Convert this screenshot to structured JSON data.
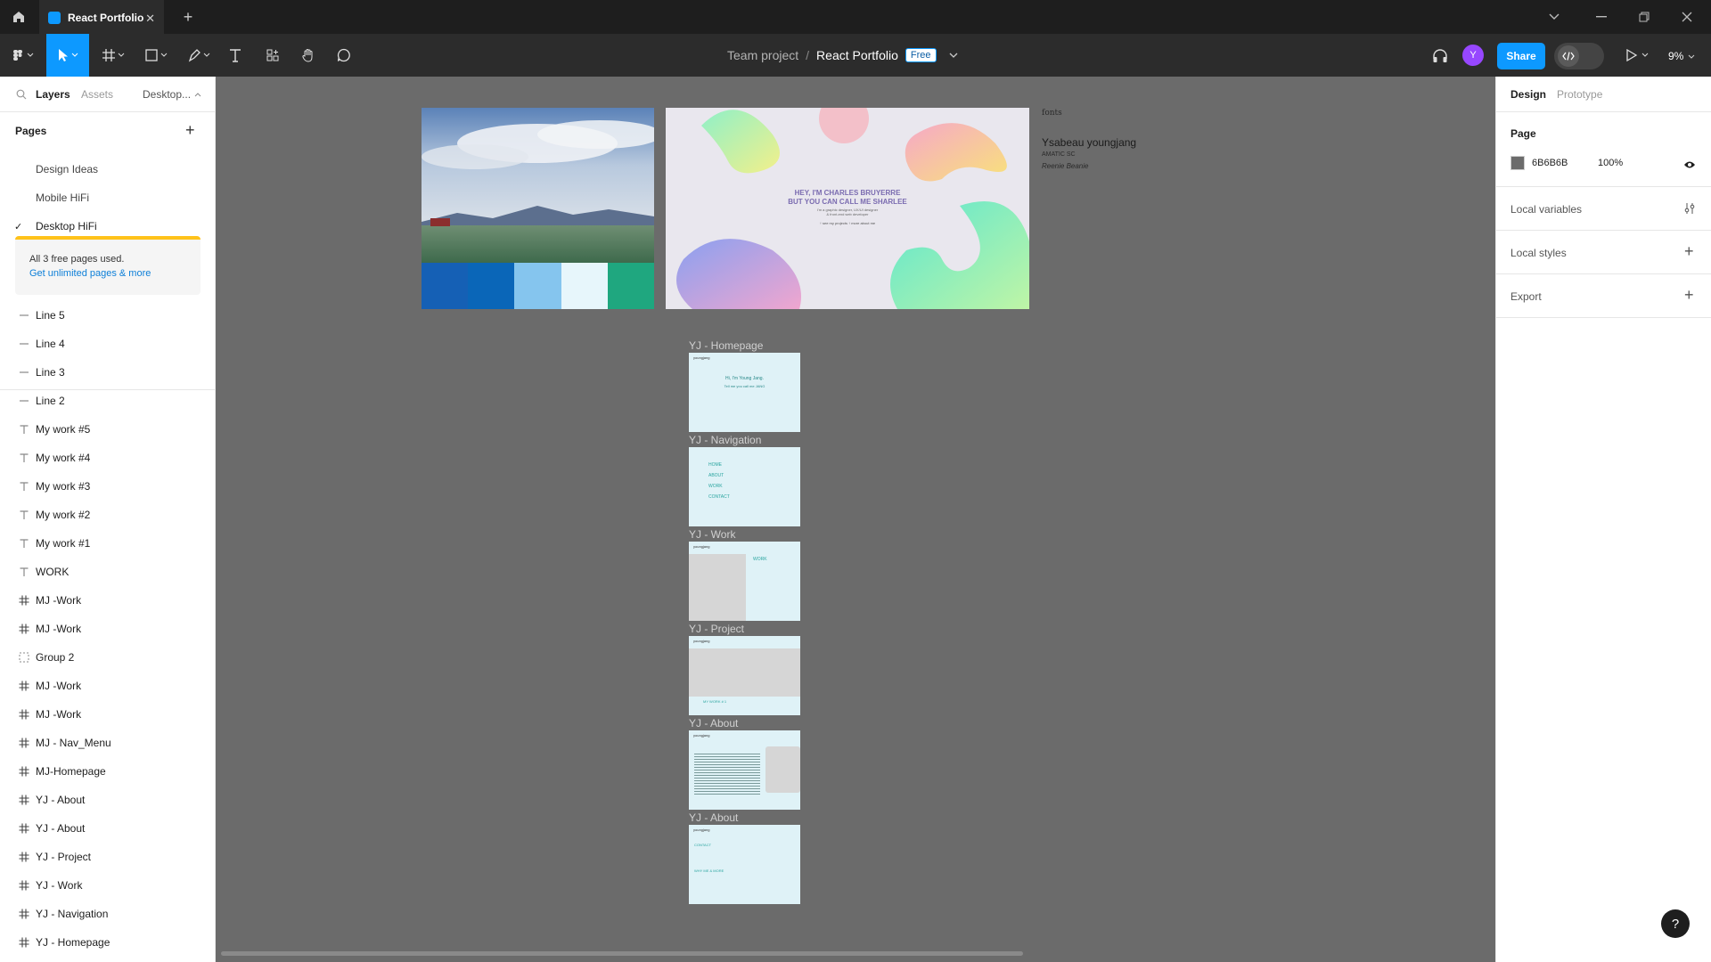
{
  "tabbar": {
    "tab_title": "React Portfolio"
  },
  "toolbar": {
    "breadcrumb_team": "Team project",
    "breadcrumb_sep": "/",
    "file_name": "React Portfolio",
    "plan_badge": "Free",
    "avatar_initial": "Y",
    "share_label": "Share",
    "zoom": "9%"
  },
  "left": {
    "tabs": [
      "Layers",
      "Assets"
    ],
    "page_selector": "Desktop...",
    "pages_title": "Pages",
    "pages": [
      "Design Ideas",
      "Mobile HiFi",
      "Desktop HiFi"
    ],
    "selected_page_index": 2,
    "notice_text": "All 3 free pages used.",
    "notice_link": "Get unlimited pages & more",
    "layers": [
      {
        "icon": "line",
        "label": "Line 5"
      },
      {
        "icon": "line",
        "label": "Line 4"
      },
      {
        "icon": "line",
        "label": "Line 3"
      },
      {
        "icon": "line",
        "label": "Line 2"
      },
      {
        "icon": "text",
        "label": "My work #5"
      },
      {
        "icon": "text",
        "label": "My work #4"
      },
      {
        "icon": "text",
        "label": "My work #3"
      },
      {
        "icon": "text",
        "label": "My work #2"
      },
      {
        "icon": "text",
        "label": "My work #1"
      },
      {
        "icon": "text",
        "label": "WORK"
      },
      {
        "icon": "frame",
        "label": "MJ -Work"
      },
      {
        "icon": "frame",
        "label": "MJ -Work"
      },
      {
        "icon": "group",
        "label": "Group 2"
      },
      {
        "icon": "frame",
        "label": "MJ -Work"
      },
      {
        "icon": "frame",
        "label": "MJ -Work"
      },
      {
        "icon": "frame",
        "label": "MJ - Nav_Menu"
      },
      {
        "icon": "frame",
        "label": "MJ-Homepage"
      },
      {
        "icon": "frame",
        "label": "YJ - About"
      },
      {
        "icon": "frame",
        "label": "YJ - About"
      },
      {
        "icon": "frame",
        "label": "YJ - Project"
      },
      {
        "icon": "frame",
        "label": "YJ - Work"
      },
      {
        "icon": "frame",
        "label": "YJ - Navigation"
      },
      {
        "icon": "frame",
        "label": "YJ - Homepage"
      }
    ]
  },
  "right": {
    "tabs": [
      "Design",
      "Prototype"
    ],
    "page_title": "Page",
    "page_color": "6B6B6B",
    "page_opacity": "100%",
    "local_variables": "Local variables",
    "local_styles": "Local styles",
    "export": "Export"
  },
  "canvas": {
    "palette": [
      "#1560b5",
      "#0a66b8",
      "#85c5ee",
      "#e7f6fb",
      "#1fa77f"
    ],
    "hero_line1": "HEY, I'M CHARLES BRUYERRE",
    "hero_line2": "BUT YOU CAN CALL ME SHARLEE",
    "hero_sub1": "I'm a graphic designer, UX/UI designer",
    "hero_sub2": "& front-end web developer",
    "hero_links": "↑ see my projects   ↑ more about me",
    "fonts_label": "fonts",
    "font1": "Ysabeau  youngjang",
    "font2": "AMATIC SC",
    "font3": "Reenie Beanie",
    "frame_labels": [
      "YJ - Homepage",
      "YJ - Navigation",
      "YJ - Work",
      "YJ - Project",
      "YJ - About",
      "YJ - About"
    ],
    "home_title": "Hi, I'm Young Jang.",
    "home_sub": "Tell me you call me JANG",
    "nav_items": [
      "HOME",
      "ABOUT",
      "WORK",
      "CONTACT"
    ],
    "work_heading": "WORK",
    "project_heading": "MY WORK # 1",
    "about_contact": "CONTACT",
    "about_more": "WHY ME & MORE",
    "logo_text": "youngjang"
  }
}
